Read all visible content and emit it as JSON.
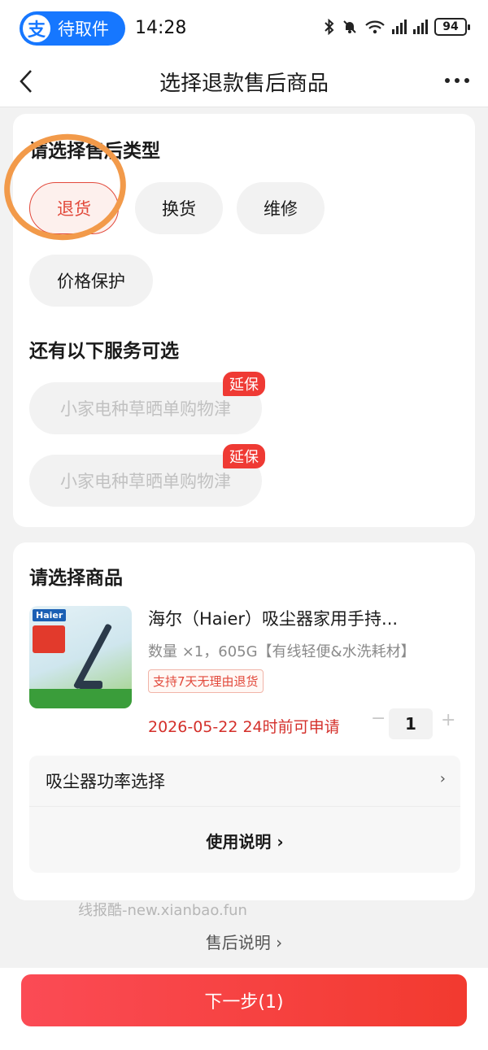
{
  "status_bar": {
    "app_badge_logo": "支",
    "app_badge_text": "待取件",
    "time": "14:28",
    "battery": "94"
  },
  "nav": {
    "title": "选择退款售后商品"
  },
  "service_type": {
    "heading": "请选择售后类型",
    "options": [
      {
        "label": "退货",
        "selected": true
      },
      {
        "label": "换货",
        "selected": false
      },
      {
        "label": "维修",
        "selected": false
      },
      {
        "label": "价格保护",
        "selected": false
      }
    ]
  },
  "extra_services": {
    "heading": "还有以下服务可选",
    "items": [
      {
        "label": "小家电种草晒单购物津",
        "badge": "延保"
      },
      {
        "label": "小家电种草晒单购物津",
        "badge": "延保"
      }
    ]
  },
  "product_section": {
    "heading": "请选择商品",
    "image_brand": "Haier",
    "title": "海尔（Haier）吸尘器家用手持...",
    "spec": "数量 ×1，605G【有线轻便&水洗耗材】",
    "return_tag": "支持7天无理由退货",
    "deadline": "2026-05-22 24时前可申请",
    "quantity": "1",
    "minus_symbol": "−",
    "plus_symbol": "+",
    "option_label": "吸尘器功率选择",
    "option_arrow": "›",
    "usage_label": "使用说明 ›"
  },
  "watermark": "线报酷-new.xianbao.fun",
  "after_sale_link": "售后说明 ›",
  "next_button": "下一步(1)",
  "colors": {
    "accent_red": "#e2493b",
    "button_red": "#f23a2f",
    "alipay_blue": "#1677ff",
    "annotation_orange": "#f29a4a"
  }
}
